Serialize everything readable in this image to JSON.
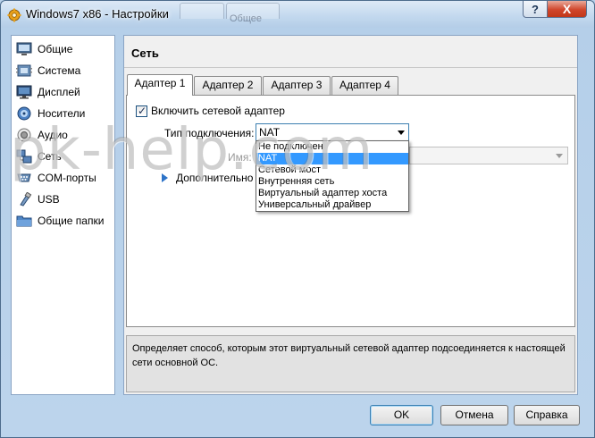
{
  "window": {
    "title": "Windows7 x86 - Настройки",
    "help_label": "?",
    "close_label": "X",
    "background_tab_label": "Общее"
  },
  "sidebar": {
    "items": [
      {
        "label": "Общие",
        "icon": "general-icon"
      },
      {
        "label": "Система",
        "icon": "system-icon"
      },
      {
        "label": "Дисплей",
        "icon": "display-icon"
      },
      {
        "label": "Носители",
        "icon": "storage-icon"
      },
      {
        "label": "Аудио",
        "icon": "audio-icon"
      },
      {
        "label": "Сеть",
        "icon": "network-icon"
      },
      {
        "label": "COM-порты",
        "icon": "serial-port-icon"
      },
      {
        "label": "USB",
        "icon": "usb-icon"
      },
      {
        "label": "Общие папки",
        "icon": "shared-folder-icon"
      }
    ]
  },
  "panel": {
    "title": "Сеть",
    "tabs": [
      "Адаптер 1",
      "Адаптер 2",
      "Адаптер 3",
      "Адаптер 4"
    ],
    "active_tab": 0,
    "enable_adapter_label": "Включить сетевой адаптер",
    "enable_adapter_checked": true,
    "tick_glyph": "✓",
    "connection_type_label": "Тип подключения:",
    "connection_type_value": "NAT",
    "connection_options": [
      "Не подключен",
      "NAT",
      "Сетевой мост",
      "Внутренняя сеть",
      "Виртуальный адаптер хоста",
      "Универсальный драйвер"
    ],
    "selected_option": 1,
    "name_label": "Имя:",
    "advanced_label": "Дополнительно",
    "description": "Определяет способ, которым этот виртуальный сетевой адаптер подсоединяется к настоящей сети основной ОС."
  },
  "buttons": {
    "ok": "OK",
    "cancel": "Отмена",
    "help": "Справка"
  },
  "watermark": "pk-help.com",
  "colors": {
    "selection": "#3399ff",
    "close_button": "#c13718",
    "focus_border": "#3c7fb1"
  }
}
